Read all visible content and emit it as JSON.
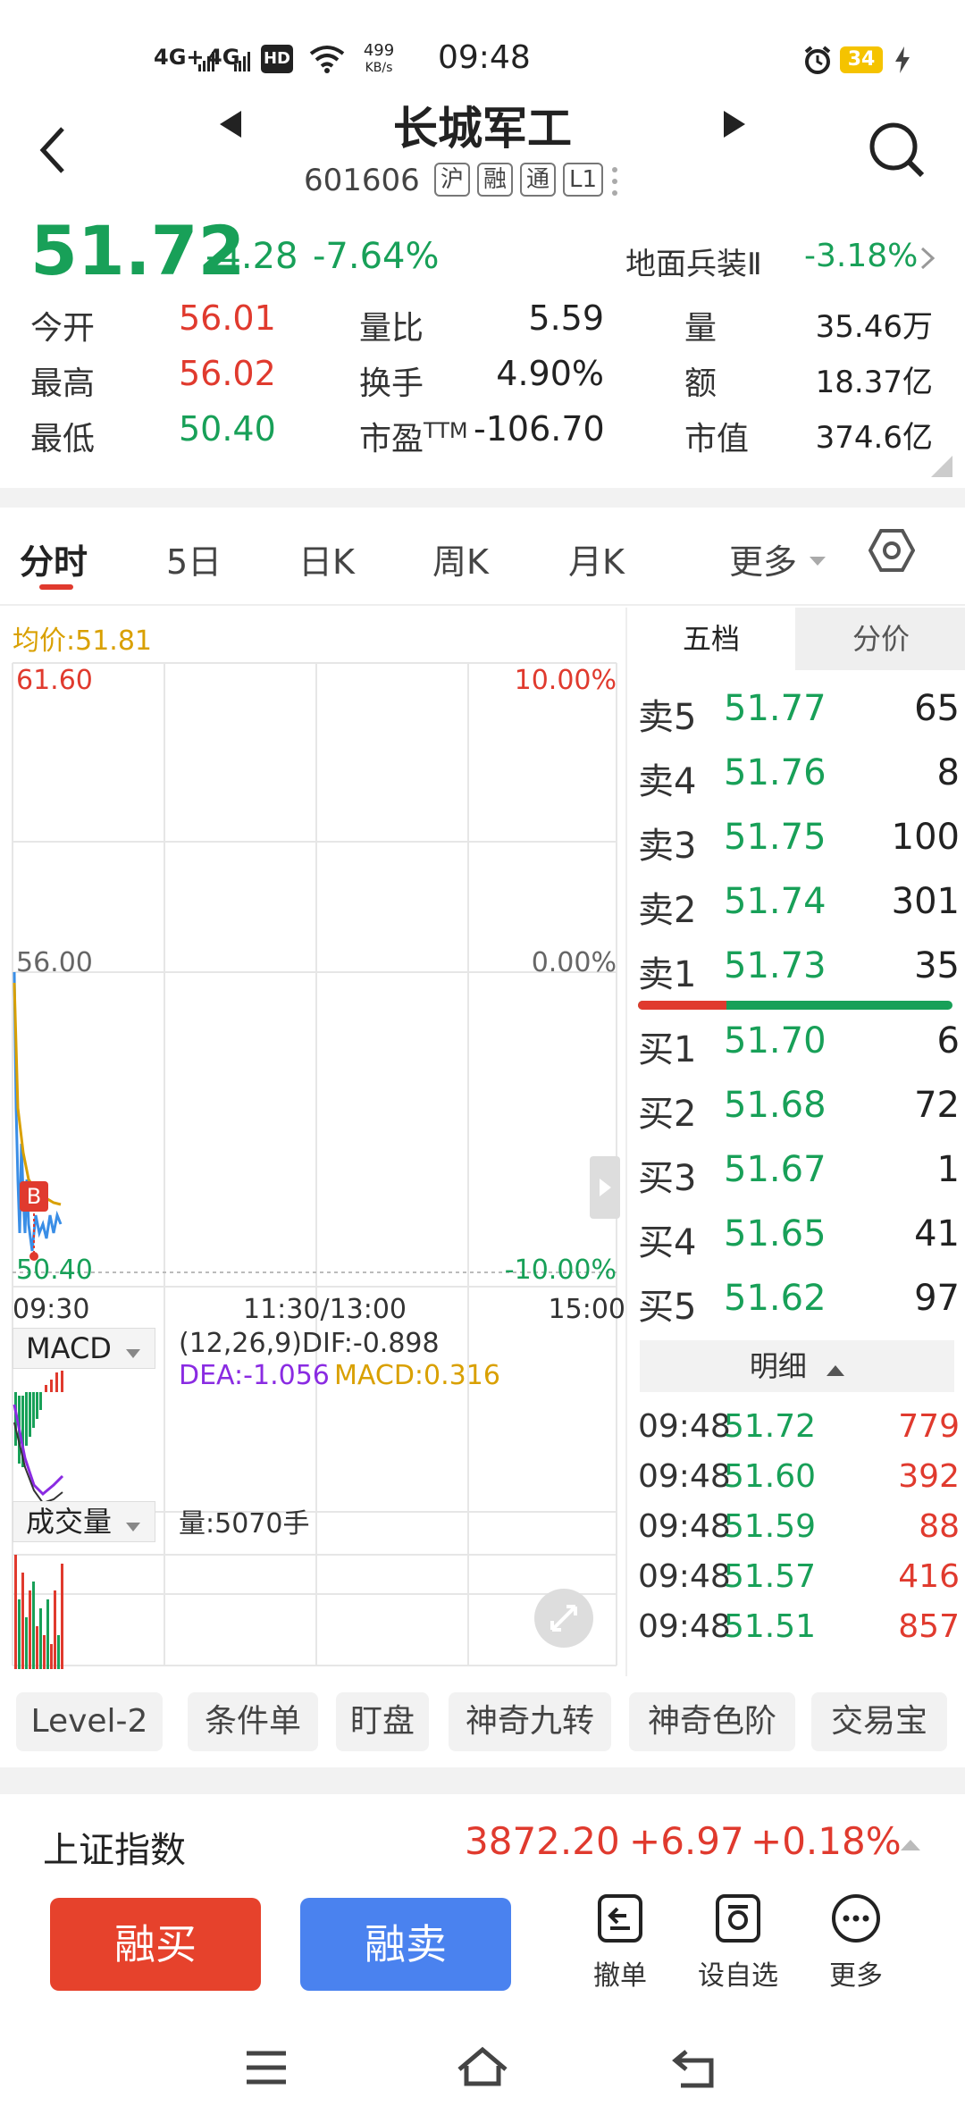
{
  "status_bar": {
    "network1": "4G+",
    "network2": "4G",
    "hd": "HD",
    "speed": "499",
    "speed_unit": "KB/s",
    "time": "09:48",
    "battery": "34"
  },
  "header": {
    "title": "长城军工",
    "code": "601606",
    "tags": [
      "沪",
      "融",
      "通",
      "L1"
    ]
  },
  "quote": {
    "price": "51.72",
    "change": "-4.28",
    "change_pct": "-7.64%",
    "sector_name": "地面兵装Ⅱ",
    "sector_change": "-3.18%",
    "open_label": "今开",
    "open": "56.01",
    "vol_ratio_label": "量比",
    "vol_ratio": "5.59",
    "volume_label": "量",
    "volume": "35.46万",
    "high_label": "最高",
    "high": "56.02",
    "turnover_label": "换手",
    "turnover": "4.90%",
    "amount_label": "额",
    "amount": "18.37亿",
    "low_label": "最低",
    "low": "50.40",
    "pe_label": "市盈",
    "pe_sup": "TTM",
    "pe": "-106.70",
    "mcap_label": "市值",
    "mcap": "374.6亿"
  },
  "tabs": {
    "items": [
      "分时",
      "5日",
      "日K",
      "周K",
      "月K",
      "更多"
    ],
    "active": "分时"
  },
  "chart": {
    "avg_label": "均价:51.81",
    "y_top": "61.60",
    "y_top_pct": "10.00%",
    "y_mid": "56.00",
    "y_mid_pct": "0.00%",
    "y_bottom": "50.40",
    "y_bottom_pct": "-10.00%",
    "x_start": "09:30",
    "x_mid": "11:30/13:00",
    "x_end": "15:00",
    "buy_marker": "B",
    "macd_selector": "MACD",
    "macd_params": "(12,26,9)DIF:-0.898",
    "macd_dea": "DEA:-1.056",
    "macd_val": "MACD:0.316",
    "vol_selector": "成交量",
    "vol_text": "量:5070手"
  },
  "book": {
    "tab_active": "五档",
    "tab_other": "分价",
    "sells": [
      {
        "label": "卖5",
        "price": "51.77",
        "vol": "65"
      },
      {
        "label": "卖4",
        "price": "51.76",
        "vol": "8"
      },
      {
        "label": "卖3",
        "price": "51.75",
        "vol": "100"
      },
      {
        "label": "卖2",
        "price": "51.74",
        "vol": "301"
      },
      {
        "label": "卖1",
        "price": "51.73",
        "vol": "35"
      }
    ],
    "buy_ratio": 0.28,
    "buys": [
      {
        "label": "买1",
        "price": "51.70",
        "vol": "6"
      },
      {
        "label": "买2",
        "price": "51.68",
        "vol": "72"
      },
      {
        "label": "买3",
        "price": "51.67",
        "vol": "1"
      },
      {
        "label": "买4",
        "price": "51.65",
        "vol": "41"
      },
      {
        "label": "买5",
        "price": "51.62",
        "vol": "97"
      }
    ],
    "detail_label": "明细",
    "trades": [
      {
        "time": "09:48",
        "price": "51.72",
        "vol": "779"
      },
      {
        "time": "09:48",
        "price": "51.60",
        "vol": "392"
      },
      {
        "time": "09:48",
        "price": "51.59",
        "vol": "88"
      },
      {
        "time": "09:48",
        "price": "51.57",
        "vol": "416"
      },
      {
        "time": "09:48",
        "price": "51.51",
        "vol": "857"
      }
    ]
  },
  "tools": [
    "Level-2",
    "条件单",
    "盯盘",
    "神奇九转",
    "神奇色阶",
    "交易宝"
  ],
  "index_bar": {
    "name": "上证指数",
    "value": "3872.20",
    "change": "+6.97",
    "change_pct": "+0.18%"
  },
  "actions": {
    "buy": "融买",
    "sell": "融卖",
    "cancel": "撤单",
    "watchlist": "设自选",
    "more": "更多"
  },
  "colors": {
    "up": "#e03a2e",
    "down": "#18a058",
    "sell_button": "#4a82ef",
    "buy_button": "#e6422c",
    "avg_line": "#d9a000",
    "price_line": "#3a8ee6"
  }
}
